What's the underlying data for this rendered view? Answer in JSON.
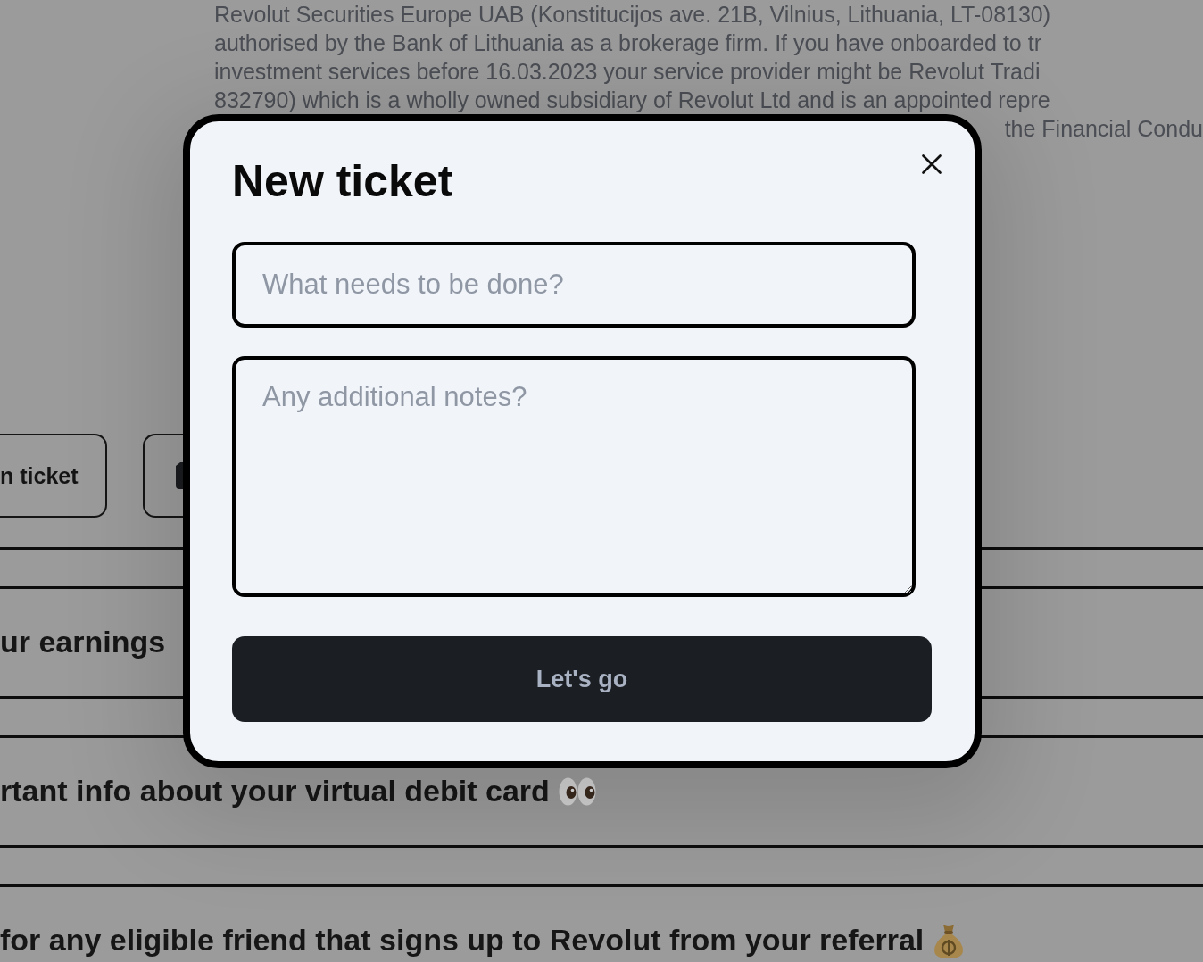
{
  "background": {
    "disclosure_lines": [
      "Revolut Securities Europe UAB (Konstitucijos ave. 21B, Vilnius, Lithuania, LT-08130)",
      "authorised by the Bank of Lithuania as a brokerage firm. If you have onboarded to tr",
      "investment services before 16.03.2023 your service provider might be Revolut Tradi",
      "832790) which is a wholly owned subsidiary of Revolut Ltd and is an appointed repre"
    ],
    "disclosure_tail": "the Financial Condu",
    "ticket_button": {
      "label": "n ticket"
    },
    "rows": [
      {
        "text": "ur earnings"
      },
      {
        "text": "rtant info about your virtual debit card"
      },
      {
        "text": "for any eligible friend that signs up to Revolut from your referral"
      }
    ]
  },
  "dialog": {
    "title": "New ticket",
    "task_field": {
      "placeholder": "What needs to be done?"
    },
    "notes_field": {
      "placeholder": "Any additional notes?"
    },
    "submit_button": {
      "label": "Let's go"
    }
  }
}
